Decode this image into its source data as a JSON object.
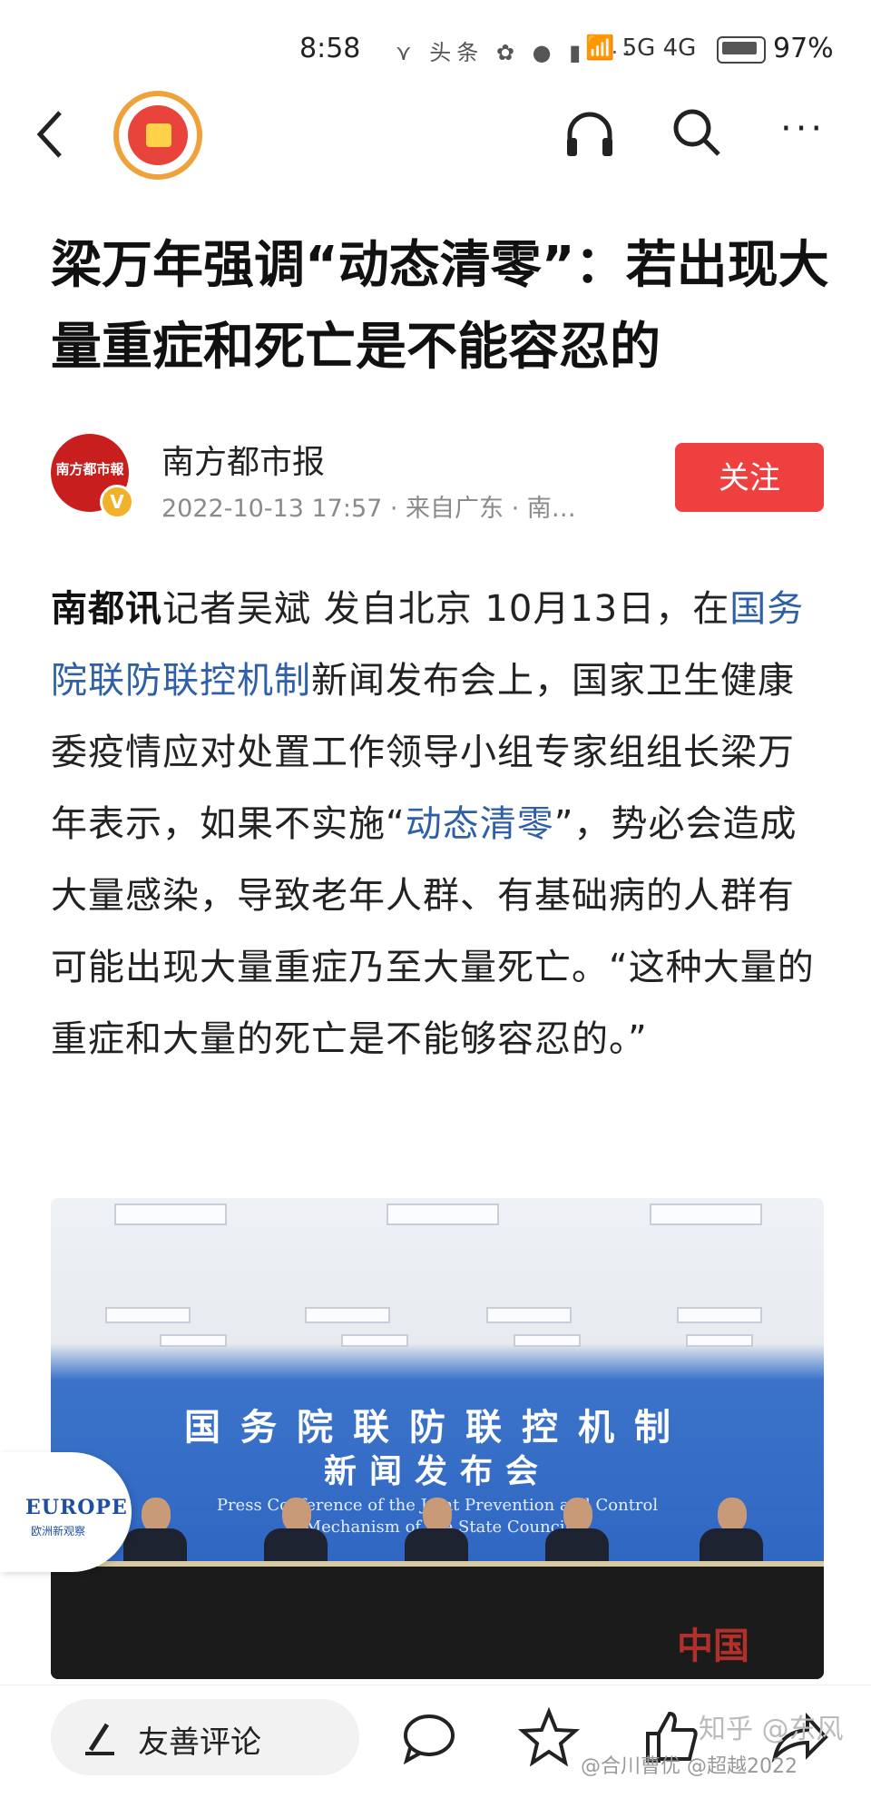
{
  "status_bar": {
    "time": "8:58",
    "notif_icons": "⋎ 头条 ✿ ● ▮ ···",
    "network": "📶 5G 4G",
    "battery_pct": "97%"
  },
  "nav": {
    "back_icon": "chevron-left-icon",
    "redpack_icon": "red-envelope-icon",
    "headset_icon": "headphones-icon",
    "search_icon": "search-icon",
    "more_label": "···"
  },
  "article": {
    "title": "梁万年强调“动态清零”：若出现大量重症和死亡是不能容忍的",
    "source_name": "南方都市报",
    "source_logo_text": "南方都市報",
    "verified_badge": "V",
    "meta": "2022-10-13 17:57 · 来自广东 · 南…",
    "follow_label": "关注",
    "para": {
      "lead": "南都讯",
      "p1": "记者吴斌 发自北京 10月13日，在",
      "link1": "国务院联防联控机制",
      "p2": "新闻发布会上，国家卫生健康委疫情应对处置工作领导小组专家组组长梁万年表示，如果不实施“",
      "link2": "动态清零",
      "p3": "”，势必会造成大量感染，导致老年人群、有基础病的人群有可能出现大量重症乃至大量死亡。“这种大量的重症和大量的死亡是不能够容忍的。”"
    }
  },
  "photo": {
    "board_line1": "国务院联防联控机制",
    "board_line2": "新闻发布会",
    "board_en1": "Press Conference of the Joint Prevention and Control",
    "board_en2": "Mechanism of the State Council",
    "corner_logo": "中国"
  },
  "overlay": {
    "europe_title": "EUROPE",
    "europe_sub": "欧洲新观察"
  },
  "bottom_bar": {
    "comment_placeholder": "友善评论",
    "comment_icon": "speech-bubble-icon",
    "star_icon": "star-icon",
    "like_icon": "thumbs-up-icon",
    "share_icon": "share-icon",
    "watermark": "@合川曹优 @超越2022",
    "zhihu_watermark": "知乎 @东风"
  }
}
